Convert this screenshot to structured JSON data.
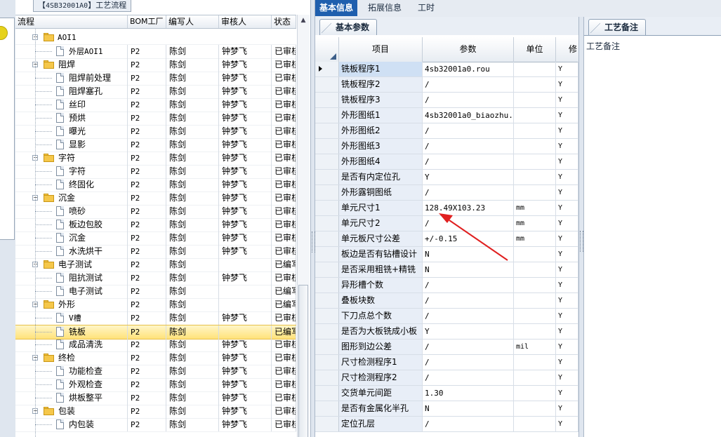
{
  "left_panel": {
    "tab_prefix": "【",
    "tab_code": "4SB32001A0",
    "tab_suffix": "】工艺流程",
    "columns": [
      "流程",
      "BOM工厂",
      "编写人",
      "审核人",
      "状态"
    ],
    "rows": [
      {
        "type": "doc",
        "level": 1,
        "label": "外层AOI1",
        "factory": "P2",
        "writer": "陈剑",
        "reviewer": "钟梦飞",
        "status": "已审核"
      },
      {
        "type": "folder",
        "level": 0,
        "label": "阻焊",
        "factory": "P2",
        "writer": "陈剑",
        "reviewer": "钟梦飞",
        "status": "已审核"
      },
      {
        "type": "doc",
        "level": 1,
        "label": "阻焊前处理",
        "factory": "P2",
        "writer": "陈剑",
        "reviewer": "钟梦飞",
        "status": "已审核"
      },
      {
        "type": "doc",
        "level": 1,
        "label": "阻焊塞孔",
        "factory": "P2",
        "writer": "陈剑",
        "reviewer": "钟梦飞",
        "status": "已审核"
      },
      {
        "type": "doc",
        "level": 1,
        "label": "丝印",
        "factory": "P2",
        "writer": "陈剑",
        "reviewer": "钟梦飞",
        "status": "已审核"
      },
      {
        "type": "doc",
        "level": 1,
        "label": "预烘",
        "factory": "P2",
        "writer": "陈剑",
        "reviewer": "钟梦飞",
        "status": "已审核"
      },
      {
        "type": "doc",
        "level": 1,
        "label": "曝光",
        "factory": "P2",
        "writer": "陈剑",
        "reviewer": "钟梦飞",
        "status": "已审核"
      },
      {
        "type": "doc",
        "level": 1,
        "label": "显影",
        "factory": "P2",
        "writer": "陈剑",
        "reviewer": "钟梦飞",
        "status": "已审核"
      },
      {
        "type": "folder",
        "level": 0,
        "label": "字符",
        "factory": "P2",
        "writer": "陈剑",
        "reviewer": "钟梦飞",
        "status": "已审核"
      },
      {
        "type": "doc",
        "level": 1,
        "label": "字符",
        "factory": "P2",
        "writer": "陈剑",
        "reviewer": "钟梦飞",
        "status": "已审核"
      },
      {
        "type": "doc",
        "level": 1,
        "label": "终固化",
        "factory": "P2",
        "writer": "陈剑",
        "reviewer": "钟梦飞",
        "status": "已审核"
      },
      {
        "type": "folder",
        "level": 0,
        "label": "沉金",
        "factory": "P2",
        "writer": "陈剑",
        "reviewer": "钟梦飞",
        "status": "已审核"
      },
      {
        "type": "doc",
        "level": 1,
        "label": "喷砂",
        "factory": "P2",
        "writer": "陈剑",
        "reviewer": "钟梦飞",
        "status": "已审核"
      },
      {
        "type": "doc",
        "level": 1,
        "label": "板边包胶",
        "factory": "P2",
        "writer": "陈剑",
        "reviewer": "钟梦飞",
        "status": "已审核"
      },
      {
        "type": "doc",
        "level": 1,
        "label": "沉金",
        "factory": "P2",
        "writer": "陈剑",
        "reviewer": "钟梦飞",
        "status": "已审核"
      },
      {
        "type": "doc",
        "level": 1,
        "label": "水洗烘干",
        "factory": "P2",
        "writer": "陈剑",
        "reviewer": "钟梦飞",
        "status": "已审核"
      },
      {
        "type": "folder",
        "level": 0,
        "label": "电子测试",
        "factory": "P2",
        "writer": "陈剑",
        "reviewer": "",
        "status": "已编写"
      },
      {
        "type": "doc",
        "level": 1,
        "label": "阻抗测试",
        "factory": "P2",
        "writer": "陈剑",
        "reviewer": "钟梦飞",
        "status": "已审核"
      },
      {
        "type": "doc",
        "level": 1,
        "label": "电子测试",
        "factory": "P2",
        "writer": "陈剑",
        "reviewer": "",
        "status": "已编写"
      },
      {
        "type": "folder",
        "level": 0,
        "label": "外形",
        "factory": "P2",
        "writer": "陈剑",
        "reviewer": "",
        "status": "已编写"
      },
      {
        "type": "doc",
        "level": 1,
        "label": "V槽",
        "factory": "P2",
        "writer": "陈剑",
        "reviewer": "钟梦飞",
        "status": "已审核"
      },
      {
        "type": "doc",
        "level": 1,
        "label": "铣板",
        "factory": "P2",
        "writer": "陈剑",
        "reviewer": "",
        "status": "已编写",
        "selected": true
      },
      {
        "type": "doc",
        "level": 1,
        "label": "成品清洗",
        "factory": "P2",
        "writer": "陈剑",
        "reviewer": "钟梦飞",
        "status": "已审核"
      },
      {
        "type": "folder",
        "level": 0,
        "label": "终检",
        "factory": "P2",
        "writer": "陈剑",
        "reviewer": "钟梦飞",
        "status": "已审核"
      },
      {
        "type": "doc",
        "level": 1,
        "label": "功能检查",
        "factory": "P2",
        "writer": "陈剑",
        "reviewer": "钟梦飞",
        "status": "已审核"
      },
      {
        "type": "doc",
        "level": 1,
        "label": "外观检查",
        "factory": "P2",
        "writer": "陈剑",
        "reviewer": "钟梦飞",
        "status": "已审核"
      },
      {
        "type": "doc",
        "level": 1,
        "label": "烘板整平",
        "factory": "P2",
        "writer": "陈剑",
        "reviewer": "钟梦飞",
        "status": "已审核"
      },
      {
        "type": "folder",
        "level": 0,
        "label": "包装",
        "factory": "P2",
        "writer": "陈剑",
        "reviewer": "钟梦飞",
        "status": "已审核"
      },
      {
        "type": "doc",
        "level": 1,
        "label": "内包装",
        "factory": "P2",
        "writer": "陈剑",
        "reviewer": "钟梦飞",
        "status": "已审核"
      }
    ],
    "partial_top_label": "AOI1"
  },
  "top_tabs": [
    "基本信息",
    "拓展信息",
    "工时"
  ],
  "sub_tab": "基本参数",
  "params_grid": {
    "columns": [
      "项目",
      "参数",
      "单位",
      "修"
    ],
    "rows": [
      {
        "item": "铣板程序1",
        "param": "4sb32001a0.rou",
        "unit": "",
        "mod": "Y",
        "current": true
      },
      {
        "item": "铣板程序2",
        "param": "/",
        "unit": "",
        "mod": "Y"
      },
      {
        "item": "铣板程序3",
        "param": "/",
        "unit": "",
        "mod": "Y"
      },
      {
        "item": "外形图纸1",
        "param": "4sb32001a0_biaozhu...",
        "unit": "",
        "mod": "Y"
      },
      {
        "item": "外形图纸2",
        "param": "/",
        "unit": "",
        "mod": "Y"
      },
      {
        "item": "外形图纸3",
        "param": "/",
        "unit": "",
        "mod": "Y"
      },
      {
        "item": "外形图纸4",
        "param": "/",
        "unit": "",
        "mod": "Y"
      },
      {
        "item": "是否有内定位孔",
        "param": "Y",
        "unit": "",
        "mod": "Y"
      },
      {
        "item": "外形露铜图纸",
        "param": "/",
        "unit": "",
        "mod": "Y"
      },
      {
        "item": "单元尺寸1",
        "param": "128.49X103.23",
        "unit": "mm",
        "mod": "Y"
      },
      {
        "item": "单元尺寸2",
        "param": "/",
        "unit": "mm",
        "mod": "Y"
      },
      {
        "item": "单元板尺寸公差",
        "param": "+/-0.15",
        "unit": "mm",
        "mod": "Y"
      },
      {
        "item": "板边是否有钻槽设计",
        "param": "N",
        "unit": "",
        "mod": "Y"
      },
      {
        "item": "是否采用粗铣+精铣",
        "param": "N",
        "unit": "",
        "mod": "Y"
      },
      {
        "item": "异形槽个数",
        "param": "/",
        "unit": "",
        "mod": "Y"
      },
      {
        "item": "叠板块数",
        "param": "/",
        "unit": "",
        "mod": "Y"
      },
      {
        "item": "下刀点总个数",
        "param": "/",
        "unit": "",
        "mod": "Y"
      },
      {
        "item": "是否为大板铣成小板",
        "param": "Y",
        "unit": "",
        "mod": "Y"
      },
      {
        "item": "图形到边公差",
        "param": "/",
        "unit": "mil",
        "mod": "Y"
      },
      {
        "item": "尺寸检测程序1",
        "param": "/",
        "unit": "",
        "mod": "Y"
      },
      {
        "item": "尺寸检测程序2",
        "param": "/",
        "unit": "",
        "mod": "Y"
      },
      {
        "item": "交货单元间距",
        "param": "1.30",
        "unit": "",
        "mod": "Y"
      },
      {
        "item": "是否有金属化半孔",
        "param": "N",
        "unit": "",
        "mod": "Y"
      },
      {
        "item": "定位孔层",
        "param": "/",
        "unit": "",
        "mod": "Y"
      }
    ]
  },
  "right_panel": {
    "tab": "工艺备注",
    "note_label": "工艺备注"
  },
  "colors": {
    "active_tab": "#1f5fae",
    "selection": "#ffe27a",
    "annotation_arrow": "#e02020"
  }
}
